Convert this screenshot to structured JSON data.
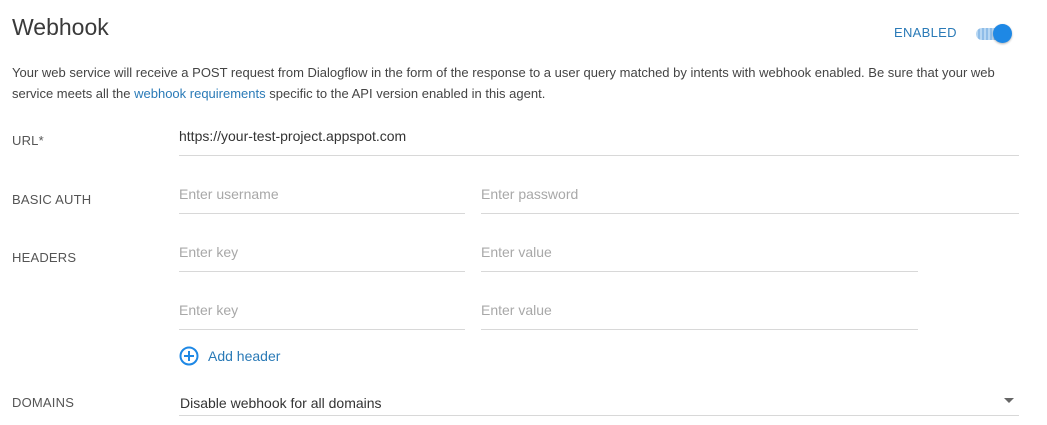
{
  "header": {
    "title": "Webhook",
    "status_label": "ENABLED",
    "toggle_on": true,
    "accent_color": "#1e88e5"
  },
  "description": {
    "text_before": "Your web service will receive a POST request from Dialogflow in the form of the response to a user query matched by intents with webhook enabled. Be sure that your web service meets all the ",
    "link_text": "webhook requirements",
    "text_after": " specific to the API version enabled in this agent."
  },
  "url": {
    "label": "URL*",
    "value": "https://your-test-project.appspot.com"
  },
  "basic_auth": {
    "label": "BASIC AUTH",
    "username_placeholder": "Enter username",
    "password_placeholder": "Enter password"
  },
  "headers": {
    "label": "HEADERS",
    "rows": [
      {
        "key_placeholder": "Enter key",
        "value_placeholder": "Enter value"
      },
      {
        "key_placeholder": "Enter key",
        "value_placeholder": "Enter value"
      }
    ],
    "add_label": "Add header",
    "add_icon": "plus-circle-icon"
  },
  "domains": {
    "label": "DOMAINS",
    "selected": "Disable webhook for all domains"
  }
}
